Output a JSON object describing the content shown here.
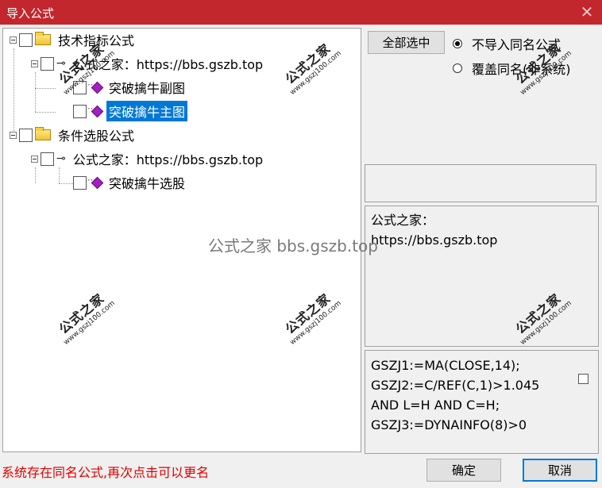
{
  "window": {
    "title": "导入公式",
    "close_symbol": "✕"
  },
  "tree": {
    "nodes": [
      {
        "label": "技术指标公式"
      },
      {
        "label": "公式之家：https://bbs.gszb.top"
      },
      {
        "label": "突破擒牛副图"
      },
      {
        "label": "突破擒牛主图",
        "selected": true
      },
      {
        "label": "条件选股公式"
      },
      {
        "label": "公式之家：https://bbs.gszb.top"
      },
      {
        "label": "突破擒牛选股"
      }
    ]
  },
  "options": {
    "select_all_label": "全部选中",
    "radio_no_import": "不导入同名公式",
    "radio_overwrite": "覆盖同名(非系统)"
  },
  "description": {
    "line1": "公式之家：",
    "line2": "https://bbs.gszb.top"
  },
  "code": [
    "GSZJ1:=MA(CLOSE,14);",
    "GSZJ2:=C/REF(C,1)>1.045",
    "AND L=H AND C=H;",
    "GSZJ3:=DYNAINFO(8)>0"
  ],
  "status_text": "系统存在同名公式,再次点击可以更名",
  "buttons": {
    "ok": "确定",
    "cancel": "取消"
  },
  "watermark": {
    "title": "公式之家",
    "url": "www.gszj100.com",
    "center_text": "公式之家 bbs.gszb.top"
  },
  "colors": {
    "titlebar": "#c1272d",
    "selection": "#0078d7",
    "status": "#e00000"
  }
}
